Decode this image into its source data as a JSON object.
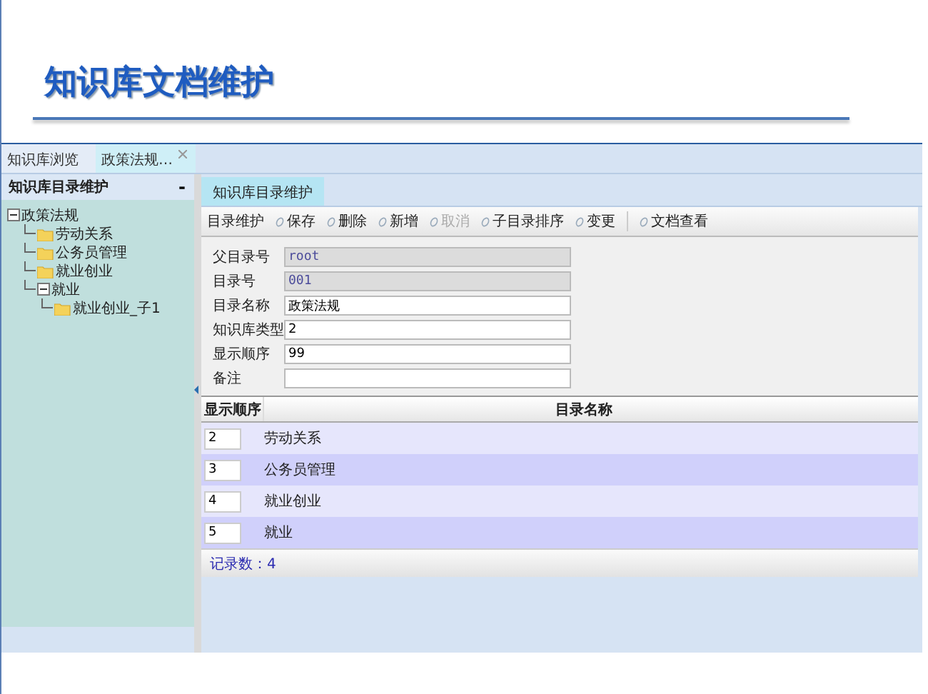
{
  "slide_title": "知识库文档维护",
  "tabs": [
    {
      "label": "知识库浏览",
      "selected": false,
      "closable": false
    },
    {
      "label": "政策法规…",
      "selected": true,
      "closable": true
    }
  ],
  "sidebar": {
    "title": "知识库目录维护",
    "collapse": "-",
    "tree": [
      {
        "label": "政策法规",
        "kind": "root",
        "expanded": true,
        "children": [
          {
            "label": "劳动关系",
            "kind": "folder"
          },
          {
            "label": "公务员管理",
            "kind": "folder"
          },
          {
            "label": "就业创业",
            "kind": "folder"
          },
          {
            "label": "就业",
            "kind": "root",
            "expanded": true,
            "children": [
              {
                "label": "就业创业_子1",
                "kind": "folder"
              }
            ]
          }
        ]
      }
    ]
  },
  "subtabs": [
    {
      "label": "知识库目录维护",
      "selected": true
    }
  ],
  "toolbar": {
    "label": "目录维护",
    "buttons": [
      {
        "label": "保存",
        "disabled": false,
        "separator_before": false
      },
      {
        "label": "删除",
        "disabled": false,
        "separator_before": false
      },
      {
        "label": "新增",
        "disabled": false,
        "separator_before": false
      },
      {
        "label": "取消",
        "disabled": true,
        "separator_before": false
      },
      {
        "label": "子目录排序",
        "disabled": false,
        "separator_before": false
      },
      {
        "label": "变更",
        "disabled": false,
        "separator_before": false
      },
      {
        "label": "文档查看",
        "disabled": false,
        "separator_before": true
      }
    ]
  },
  "form": [
    {
      "label": "父目录号",
      "value": "root",
      "readonly": true
    },
    {
      "label": "目录号",
      "value": "001",
      "readonly": true
    },
    {
      "label": "目录名称",
      "value": "政策法规",
      "readonly": false
    },
    {
      "label": "知识库类型",
      "value": "2",
      "readonly": false
    },
    {
      "label": "显示顺序",
      "value": "99",
      "readonly": false
    },
    {
      "label": "备注",
      "readonly": false
    }
  ],
  "table": {
    "columns": [
      "显示顺序",
      "目录名称"
    ],
    "rows": [
      {
        "order": "2",
        "name": "劳动关系"
      },
      {
        "order": "3",
        "name": "公务员管理"
      },
      {
        "order": "4",
        "name": "就业创业"
      },
      {
        "order": "5",
        "name": "就业"
      }
    ],
    "footer": "记录数：4"
  }
}
